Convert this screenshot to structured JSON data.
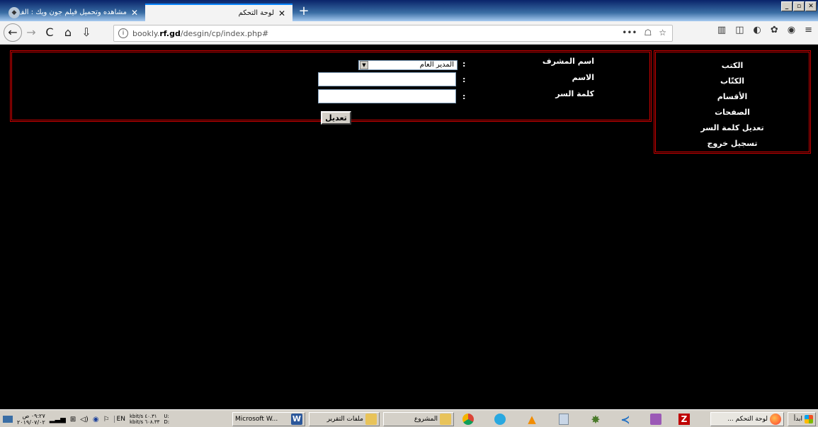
{
  "browser": {
    "tabs": [
      {
        "label": "مشاهده وتحميل فيلم جون ويك : الف",
        "close": "✕",
        "active": false
      },
      {
        "label": "لوحة التحكم",
        "close": "✕",
        "active": true
      }
    ],
    "new_tab": "+",
    "window_buttons": [
      "_",
      "▫",
      "✕"
    ],
    "url": {
      "prefix": "bookly.",
      "domain": "rf.gd",
      "path": "/desgin/cp/index.php#"
    },
    "url_actions": [
      "•••",
      "☖",
      "☆"
    ],
    "toolbar_icons": [
      "library-icon",
      "sidebar-icon",
      "extension-icon",
      "extension2-icon",
      "account-icon",
      "menu-icon"
    ]
  },
  "sidebar": {
    "items": [
      {
        "label": "الكتب"
      },
      {
        "label": "الكتّاب"
      },
      {
        "label": "الأقسام"
      },
      {
        "label": "الصفحات"
      },
      {
        "label": "تعديل كلمة السر"
      },
      {
        "label": "تسجيل خروج"
      }
    ]
  },
  "form": {
    "supervisor_label": "اسم المشرف",
    "supervisor_value": "المدير العام",
    "name_label": "الاسم",
    "password_label": "كلمة السر",
    "colon": ":",
    "submit_label": "تعديل",
    "border_color": "#cc0000"
  },
  "taskbar": {
    "clock": {
      "time": "٠٩:٢٧ ص",
      "date": "٢٠١٩/٠٧/٠٢"
    },
    "lang": "EN",
    "net": {
      "up": "kbit/s ٤٠.٣١",
      "down": "kbit/s ٦٠٨.٣٣",
      "u": "U:",
      "d": "D:"
    },
    "items": [
      {
        "label": "Microsoft W...",
        "icon_color": "#2b579a"
      },
      {
        "label": "ملفات التقرير",
        "icon_color": "#e8c35a"
      },
      {
        "label": "المشروع",
        "icon_color": "#e8c35a"
      },
      {
        "label": "لوحة التحكم ...",
        "icon_color": "#ff7139"
      }
    ],
    "start_label": "ابدأ",
    "apps": [
      "chrome-icon",
      "recycle-icon",
      "vlc-icon",
      "calculator-icon",
      "tree-icon",
      "vscode-icon",
      "editor-icon",
      "filezilla-icon"
    ]
  }
}
